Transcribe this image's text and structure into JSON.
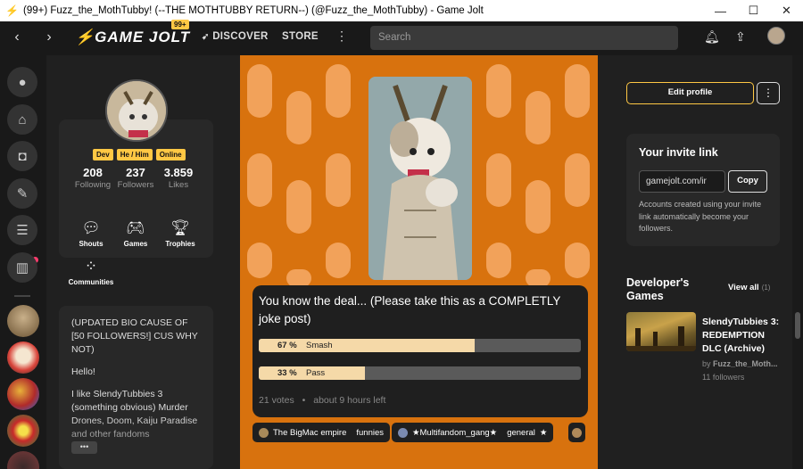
{
  "window": {
    "title": "(99+) Fuzz_the_MothTubby! (--THE MOTHTUBBY RETURN--) (@Fuzz_the_MothTubby) - Game Jolt",
    "minimize_glyph": "—",
    "maximize_glyph": "☐",
    "close_glyph": "✕"
  },
  "nav": {
    "back_glyph": "‹",
    "forward_glyph": "›",
    "logo": "GAME JOLT",
    "notification_badge": "99+",
    "discover": "DISCOVER",
    "store": "STORE",
    "more_glyph": "⋮",
    "search_placeholder": "Search"
  },
  "profile": {
    "tags": [
      "Dev",
      "He / Him",
      "Online"
    ],
    "stats": [
      {
        "value": "208",
        "label": "Following"
      },
      {
        "value": "237",
        "label": "Followers"
      },
      {
        "value": "3.859",
        "label": "Likes"
      }
    ],
    "shortcuts": [
      "Shouts",
      "Games",
      "Trophies",
      "Communities"
    ],
    "bio": [
      "(UPDATED BIO CAUSE OF [50 FOLLOWERS!] CUS WHY NOT)",
      "Hello!",
      "I like SlendyTubbies 3 (something obvious) Murder Drones, Doom, Kaiju Paradise and other fandoms"
    ],
    "bio_more": "•••"
  },
  "post": {
    "poll": {
      "question": "You know the deal... (Please take this as a COMPLETLY joke post)",
      "options": [
        {
          "percent": "67 %",
          "label": "Smash",
          "fraction": 0.67
        },
        {
          "percent": "33 %",
          "label": "Pass",
          "fraction": 0.33
        }
      ],
      "votes": "21 votes",
      "time_left": "about 9 hours left"
    },
    "communities": [
      {
        "name": "The BigMac empire",
        "channel": "funnies"
      },
      {
        "name": "★Multifandom_gang★",
        "channel": "general"
      }
    ]
  },
  "sidebar": {
    "edit_profile": "Edit profile",
    "more_glyph": "⋮",
    "invite_title": "Your invite link",
    "invite_value": "gamejolt.com/ir",
    "copy": "Copy",
    "invite_desc": "Accounts created using your invite link automatically become your followers.",
    "dev_games_title": "Developer's Games",
    "view_all": "View all",
    "view_all_count": "(1)",
    "game": {
      "title": "SlendyTubbies 3: REDEMPTION DLC (Archive)",
      "by_prefix": "by ",
      "by_name": "Fuzz_the_Moth...",
      "followers": "11 followers"
    }
  },
  "colors": {
    "accent": "#ffc844",
    "feed_bg": "#d8720e",
    "notification_dot": "#ff3c6e"
  }
}
